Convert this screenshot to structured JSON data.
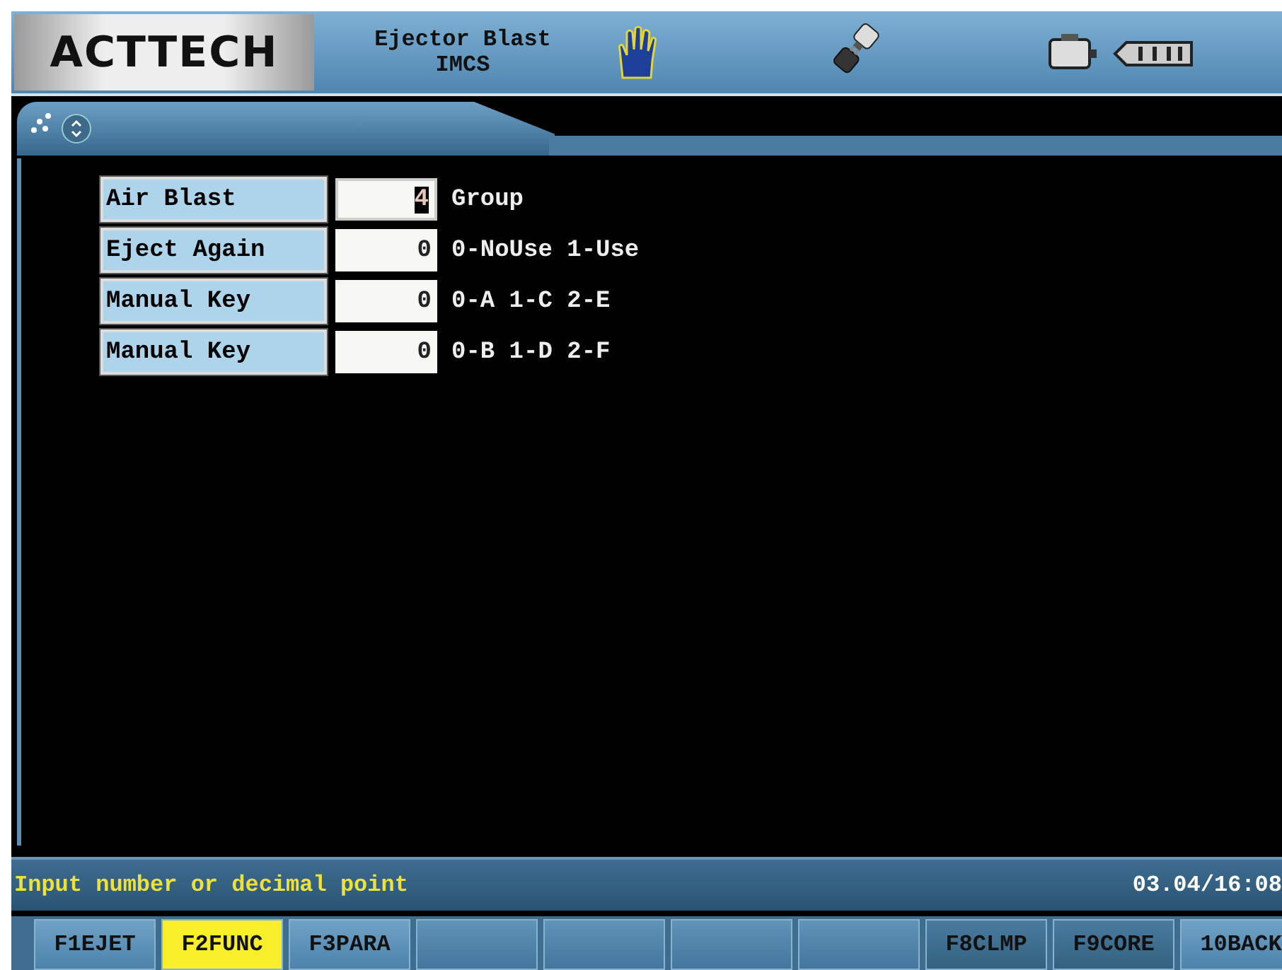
{
  "header": {
    "logo": "ACTTECH",
    "title": "Ejector Blast",
    "subtitle": "IMCS"
  },
  "rows": [
    {
      "label": "Air Blast",
      "value": "4",
      "hint": "Group",
      "focused": true
    },
    {
      "label": "Eject Again",
      "value": "0",
      "hint": "0-NoUse 1-Use",
      "focused": false
    },
    {
      "label": "Manual Key",
      "value": "0",
      "hint": "0-A 1-C 2-E",
      "focused": false
    },
    {
      "label": "Manual Key",
      "value": "0",
      "hint": "0-B 1-D 2-F",
      "focused": false
    }
  ],
  "status_bar": {
    "message": "Input number or decimal point",
    "datetime": "03.04/16:08"
  },
  "keys": [
    {
      "kind": "key",
      "label": "F1EJET",
      "selected": false
    },
    {
      "kind": "key",
      "label": "F2FUNC",
      "selected": true
    },
    {
      "kind": "key",
      "label": "F3PARA",
      "selected": false
    },
    {
      "kind": "blank",
      "selected": false
    },
    {
      "kind": "blank",
      "selected": false
    },
    {
      "kind": "blank",
      "selected": false
    },
    {
      "kind": "blank",
      "selected": false
    },
    {
      "kind": "dark",
      "label": "F8CLMP",
      "selected": false
    },
    {
      "kind": "dark",
      "label": "F9CORE",
      "selected": false
    },
    {
      "kind": "key",
      "label": "10BACK",
      "selected": false
    }
  ]
}
